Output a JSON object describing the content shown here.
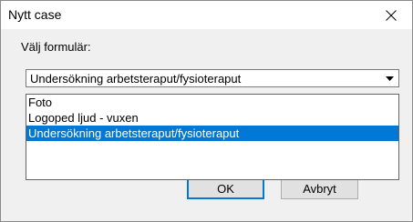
{
  "window": {
    "title": "Nytt case"
  },
  "form": {
    "label": "Välj formulär:",
    "selected_value": "Undersökning arbetsteraput/fysioteraput",
    "options": [
      "Foto",
      "Logoped ljud - vuxen",
      "Undersökning arbetsteraput/fysioteraput"
    ],
    "highlighted_option_index": 2
  },
  "buttons": {
    "ok_label": "OK",
    "cancel_label": "Avbryt"
  },
  "colors": {
    "selection": "#0078d7",
    "dialog_background": "#f0f0f0"
  },
  "icons": {
    "close": "close-icon",
    "dropdown": "chevron-down-icon"
  }
}
